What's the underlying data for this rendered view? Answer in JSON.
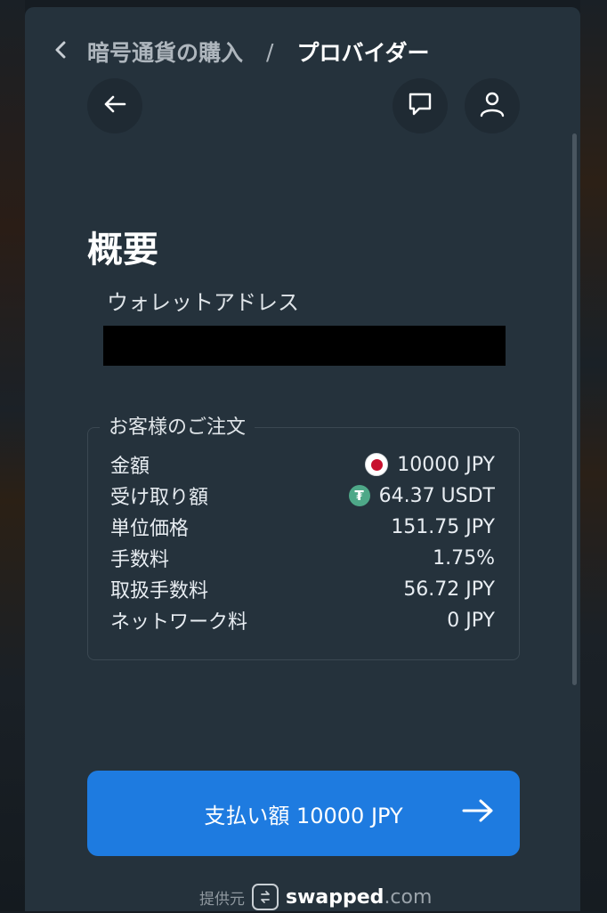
{
  "breadcrumb": {
    "parent": "暗号通貨の購入",
    "separator": "/",
    "current": "プロバイダー"
  },
  "icons": {
    "back": "arrow-left-icon",
    "chat": "chat-bubble-icon",
    "profile": "user-icon",
    "breadcrumb_back": "chevron-left-icon"
  },
  "summary": {
    "title": "概要",
    "wallet_label": "ウォレットアドレス",
    "wallet_value": ""
  },
  "order": {
    "legend": "お客様のご注文",
    "rows": [
      {
        "label": "金額",
        "value": "10000 JPY",
        "icon": "japan-flag-icon"
      },
      {
        "label": "受け取り額",
        "value": "64.37 USDT",
        "icon": "tether-icon"
      },
      {
        "label": "単位価格",
        "value": "151.75 JPY"
      },
      {
        "label": "手数料",
        "value": "1.75%"
      },
      {
        "label": "取扱手数料",
        "value": "56.72 JPY"
      },
      {
        "label": "ネットワーク料",
        "value": "0 JPY"
      }
    ]
  },
  "pay_button": {
    "label": "支払い額 10000 JPY"
  },
  "footer": {
    "provided_by": "提供元",
    "brand": "swapped",
    "brand_tld": ".com"
  },
  "colors": {
    "panel": "#25323c",
    "accent": "#1e7be0",
    "tether": "#4ea888",
    "flag_red": "#c8102e"
  }
}
